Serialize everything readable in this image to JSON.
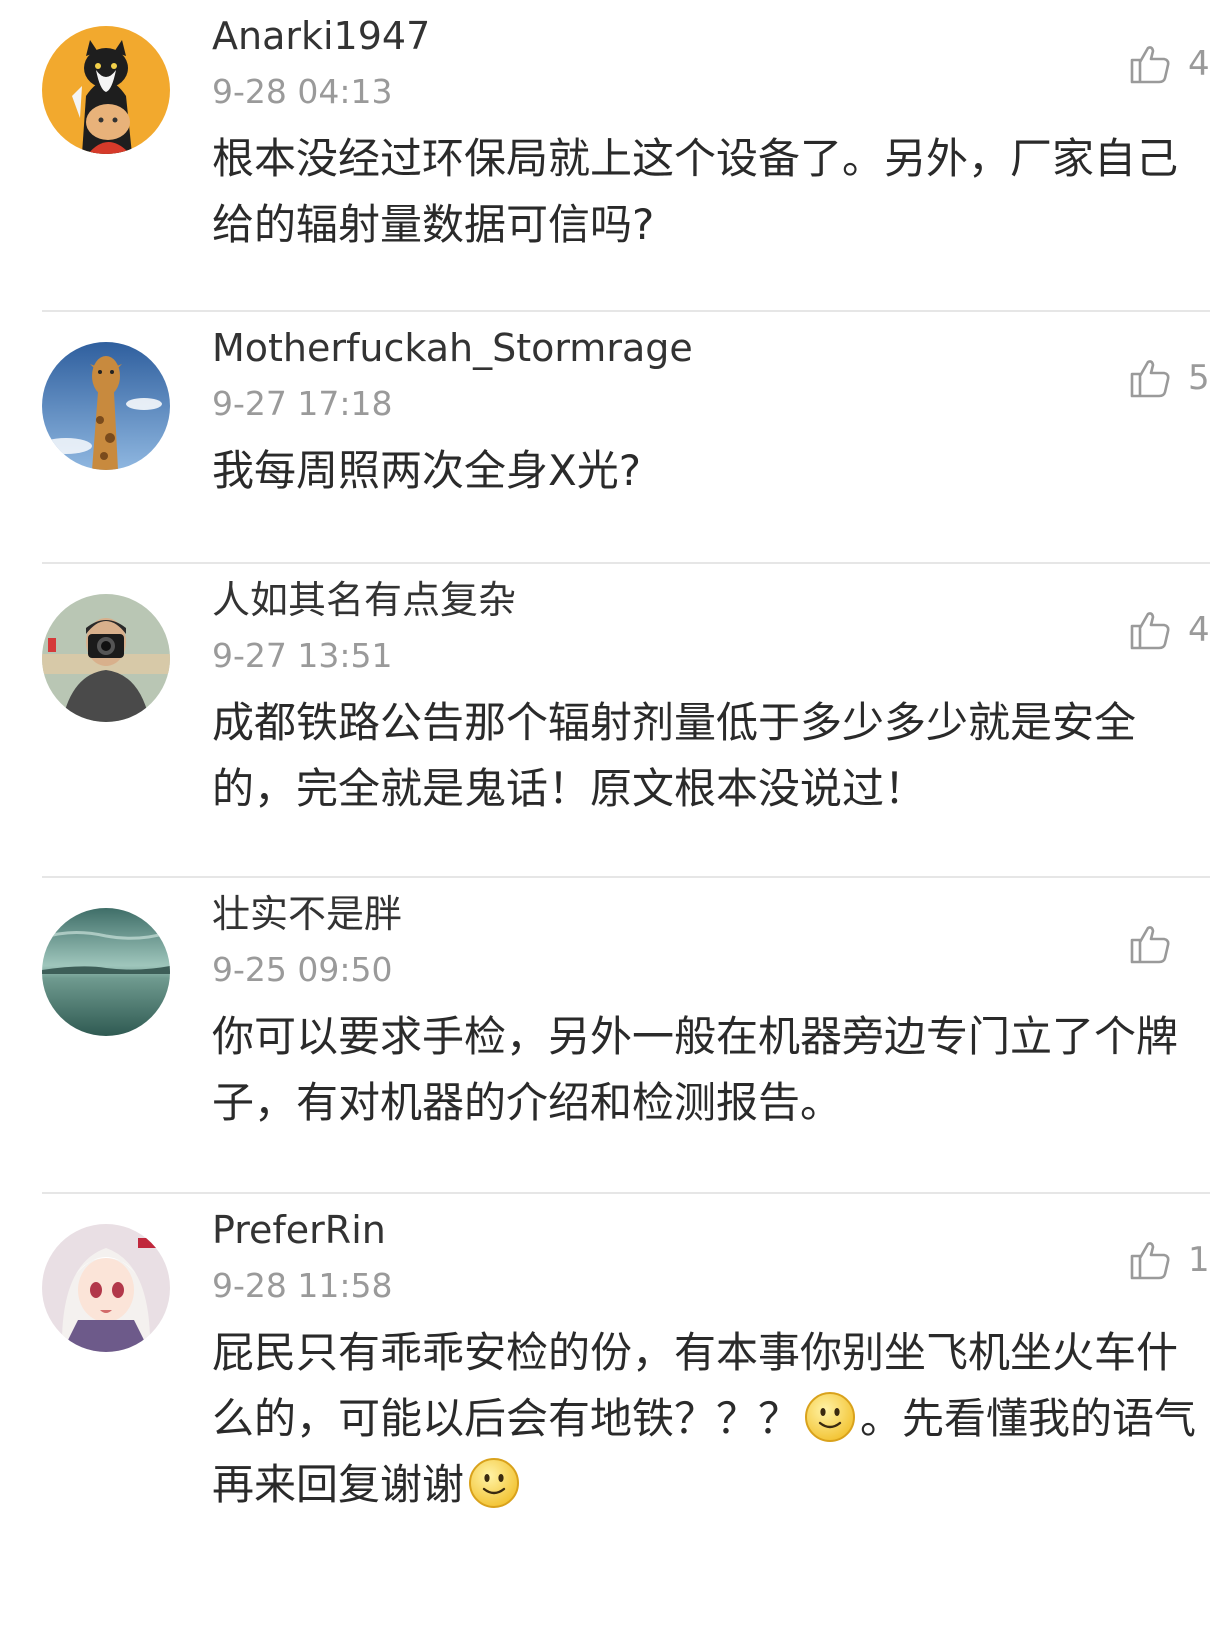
{
  "comments": [
    {
      "username": "Anarki1947",
      "time": "9-28 04:13",
      "likes": "4",
      "text": "根本没经过环保局就上这个设备了。另外，厂家自己给的辐射量数据可信吗?"
    },
    {
      "username": "Motherfuckah_Stormrage",
      "time": "9-27 17:18",
      "likes": "5",
      "text": "我每周照两次全身X光?"
    },
    {
      "username": "人如其名有点复杂",
      "time": "9-27 13:51",
      "likes": "4",
      "text": "成都铁路公告那个辐射剂量低于多少多少就是安全的，完全就是鬼话！原文根本没说过！"
    },
    {
      "username": "壮实不是胖",
      "time": "9-25 09:50",
      "likes": "",
      "text": "你可以要求手检，另外一般在机器旁边专门立了个牌子，有对机器的介绍和检测报告。"
    },
    {
      "username": "PreferRin",
      "time": "9-28 11:58",
      "likes": "1",
      "text_part1": "屁民只有乖乖安检的份，有本事你别坐飞机坐火车什么的，可能以后会有地铁？？？",
      "text_part2": "。先看懂我的语气再来回复谢谢"
    }
  ],
  "icons": {
    "like": "thumbs-up-icon",
    "emoji": "smiley-emoji-icon"
  },
  "colors": {
    "divider": "#e6e6e6",
    "meta_text": "#9a9a9a",
    "body_text": "#2a2a2a"
  }
}
